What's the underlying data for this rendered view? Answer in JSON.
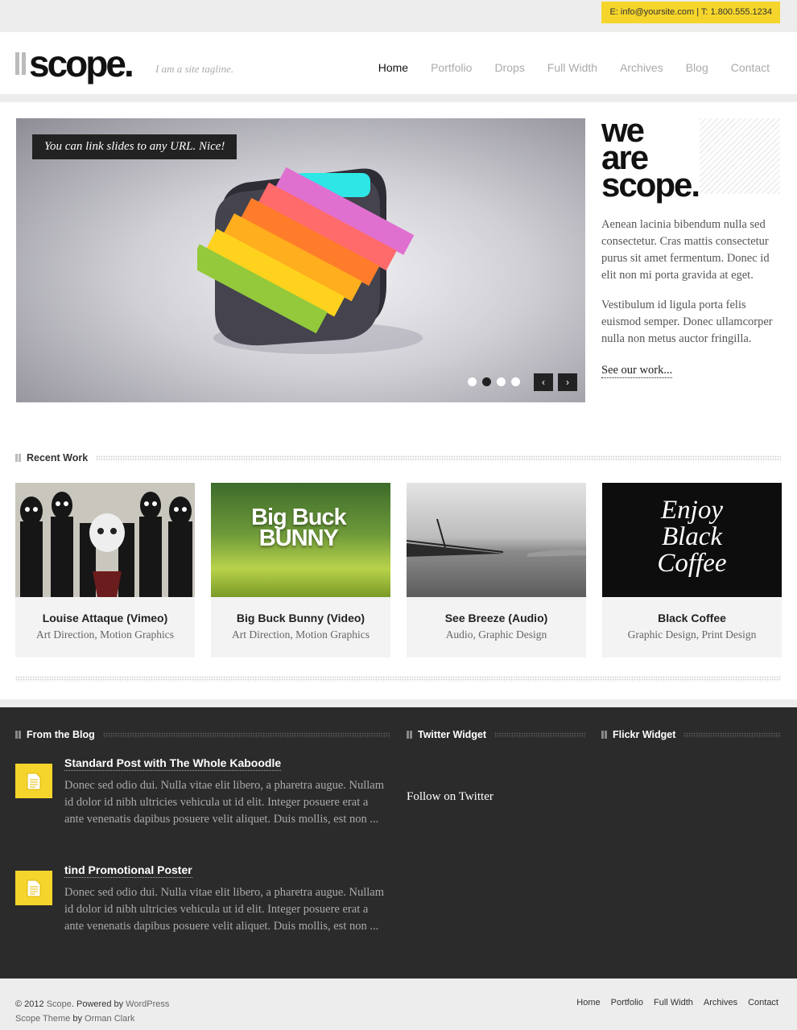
{
  "topbar": {
    "contact": "E: info@yoursite.com | T: 1.800.555.1234"
  },
  "header": {
    "logo": "scope.",
    "tagline": "I am a site tagline.",
    "nav": [
      "Home",
      "Portfolio",
      "Drops",
      "Full Width",
      "Archives",
      "Blog",
      "Contact"
    ],
    "active_nav": "Home"
  },
  "slider": {
    "caption": "You can link slides to any URL. Nice!",
    "slide_count": 4,
    "active_slide": 2,
    "prev_label": "‹",
    "next_label": "›"
  },
  "intro": {
    "title": "we\nare\nscope.",
    "paragraphs": [
      "Aenean lacinia bibendum nulla sed consectetur. Cras mattis consectetur purus sit amet fermentum. Donec id elit non mi porta gravida at eget.",
      "Vestibulum id ligula porta felis euismod semper. Donec ullamcorper nulla non metus auctor fringilla."
    ],
    "link": "See our work..."
  },
  "recent_work": {
    "heading": "Recent Work",
    "items": [
      {
        "title": "Louise Attaque (Vimeo)",
        "tags": "Art Direction, Motion Graphics"
      },
      {
        "title": "Big Buck Bunny (Video)",
        "tags": "Art Direction, Motion Graphics",
        "thumb_text": [
          "Big Buck",
          "BUNNY"
        ]
      },
      {
        "title": "See Breeze (Audio)",
        "tags": "Audio, Graphic Design"
      },
      {
        "title": "Black Coffee",
        "tags": "Graphic Design, Print Design",
        "thumb_text": [
          "Enjoy",
          "Black",
          "Coffee"
        ]
      }
    ]
  },
  "widgets": {
    "blog": {
      "heading": "From the Blog",
      "posts": [
        {
          "title": "Standard Post with The Whole Kaboodle",
          "excerpt": "Donec sed odio dui. Nulla vitae elit libero, a pharetra augue. Nullam id dolor id nibh ultricies vehicula ut id elit. Integer posuere erat a ante venenatis dapibus posuere velit aliquet. Duis mollis, est non ..."
        },
        {
          "title": "tind Promotional Poster",
          "excerpt": "Donec sed odio dui. Nulla vitae elit libero, a pharetra augue. Nullam id dolor id nibh ultricies vehicula ut id elit. Integer posuere erat a ante venenatis dapibus posuere velit aliquet. Duis mollis, est non ..."
        }
      ]
    },
    "twitter": {
      "heading": "Twitter Widget",
      "follow": "Follow on Twitter"
    },
    "flickr": {
      "heading": "Flickr Widget"
    }
  },
  "footer": {
    "copyright_prefix": "© 2012",
    "site": "Scope",
    "powered": ". Powered by",
    "platform": "WordPress",
    "theme_prefix": "Scope Theme",
    "by": "by",
    "author": "Orman Clark",
    "nav": [
      "Home",
      "Portfolio",
      "Full Width",
      "Archives",
      "Contact"
    ]
  },
  "colors": {
    "accent": "#f5d52b",
    "dark_band": "#2b2b2b",
    "page_bg": "#ededed"
  }
}
